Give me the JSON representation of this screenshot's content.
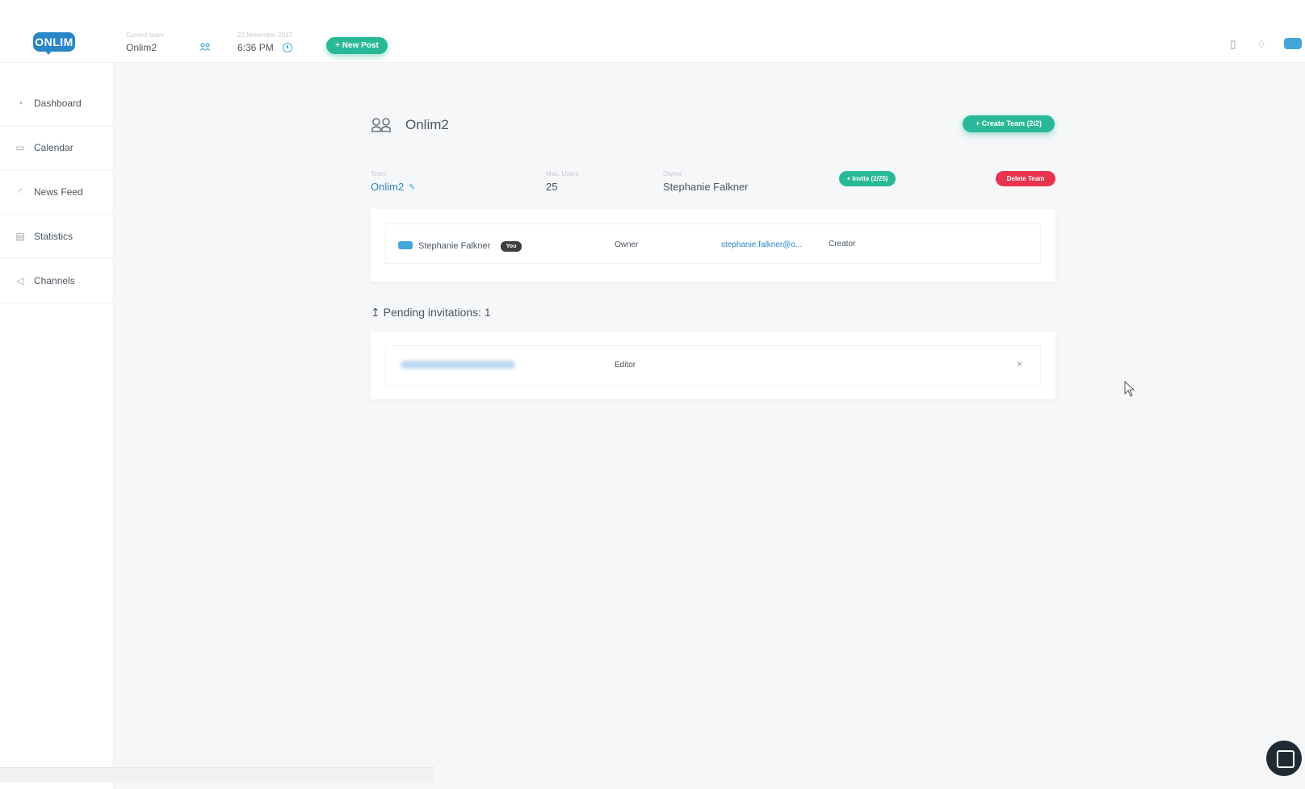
{
  "app": {
    "logo_text": "ONLIM",
    "brand_color": "#2a86c7",
    "accent_color": "#29b998",
    "danger_color": "#e8334f"
  },
  "header": {
    "current_team_label": "Current team",
    "current_team_value": "Onlim2",
    "date_label": "22 November 2017",
    "time_value": "6:36 PM",
    "new_post_label": "+ New Post",
    "icons": [
      "team-icon",
      "clock-icon",
      "document-icon",
      "bell-icon",
      "chat-icon"
    ]
  },
  "sidebar": {
    "items": [
      {
        "label": "Dashboard",
        "icon": "gauge-icon"
      },
      {
        "label": "Calendar",
        "icon": "calendar-icon"
      },
      {
        "label": "News Feed",
        "icon": "rss-icon"
      },
      {
        "label": "Statistics",
        "icon": "chart-icon"
      },
      {
        "label": "Channels",
        "icon": "megaphone-icon"
      }
    ]
  },
  "main": {
    "title": "Onlim2",
    "create_team_label": "+ Create Team (2/2)",
    "meta": {
      "team_label": "Team",
      "team_value": "Onlim2",
      "max_users_label": "Max. Users",
      "max_users_value": "25",
      "owner_label": "Owner",
      "owner_value": "Stephanie Falkner"
    },
    "invite_label": "+ Invite (2/25)",
    "delete_team_label": "Delete Team",
    "members": [
      {
        "name": "Stephanie Falkner",
        "badge": "You",
        "role": "Owner",
        "email": "stephanie.falkner@o...",
        "status": "Creator"
      }
    ],
    "pending_title": "Pending invitations: 1",
    "pending": [
      {
        "email_blurred": true,
        "role": "Editor",
        "remove_label": "×"
      }
    ]
  }
}
